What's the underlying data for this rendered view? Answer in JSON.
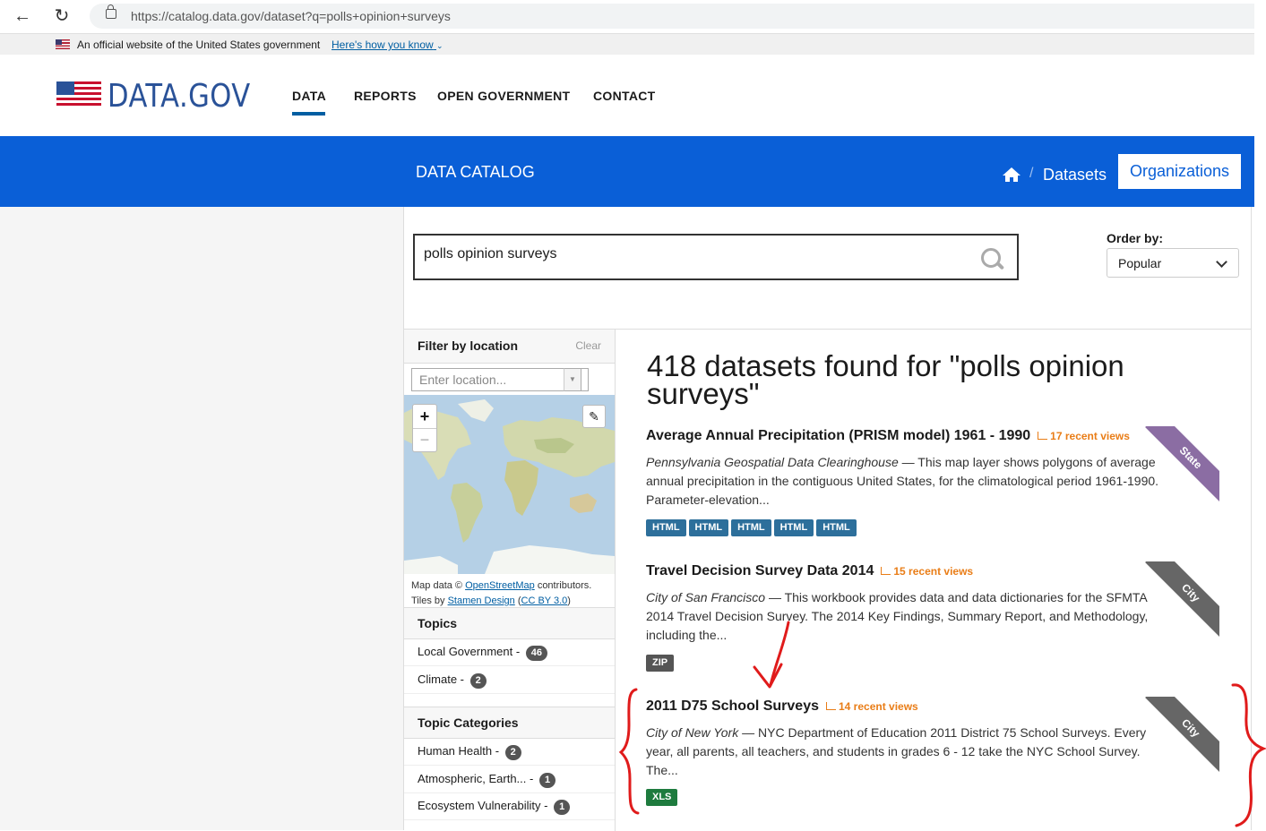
{
  "browser": {
    "url": "https://catalog.data.gov/dataset?q=polls+opinion+surveys"
  },
  "gov_banner": {
    "text": "An official website of the United States government",
    "link": "Here's how you know"
  },
  "header": {
    "logo": "DATA.GOV",
    "nav": [
      "DATA",
      "REPORTS",
      "OPEN GOVERNMENT",
      "CONTACT"
    ]
  },
  "band": {
    "title": "DATA CATALOG",
    "crumb": "Datasets",
    "org_button": "Organizations"
  },
  "search": {
    "query": "polls opinion surveys",
    "order_label": "Order by:",
    "order_value": "Popular"
  },
  "sidebar": {
    "filter_title": "Filter by location",
    "filter_clear": "Clear",
    "location_placeholder": "Enter location...",
    "map_credit_1": "Map data ©",
    "map_credit_osm": "OpenStreetMap",
    "map_credit_2": "contributors.",
    "map_credit_3": "Tiles by",
    "map_credit_stamen": "Stamen Design",
    "map_credit_cc": "CC BY 3.0",
    "topics_title": "Topics",
    "topics": [
      {
        "label": "Local Government -",
        "count": "46"
      },
      {
        "label": "Climate -",
        "count": "2"
      }
    ],
    "categories_title": "Topic Categories",
    "categories": [
      {
        "label": "Human Health -",
        "count": "2"
      },
      {
        "label": "Atmospheric, Earth... -",
        "count": "1"
      },
      {
        "label": "Ecosystem Vulnerability -",
        "count": "1"
      }
    ]
  },
  "results": {
    "heading": "418 datasets found for \"polls opinion surveys\"",
    "items": [
      {
        "title": "Average Annual Precipitation (PRISM model) 1961 - 1990",
        "views": "17 recent views",
        "source": "Pennsylvania Geospatial Data Clearinghouse",
        "desc": " — This map layer shows polygons of average annual precipitation in the contiguous United States, for the climatological period 1961-1990. Parameter-elevation...",
        "tags": [
          "HTML",
          "HTML",
          "HTML",
          "HTML",
          "HTML"
        ],
        "ribbon": "State"
      },
      {
        "title": "Travel Decision Survey Data 2014",
        "views": "15 recent views",
        "source": "City of San Francisco",
        "desc": " — This workbook provides data and data dictionaries for the SFMTA 2014 Travel Decision Survey. The 2014 Key Findings, Summary Report, and Methodology, including the...",
        "tags": [
          "ZIP"
        ],
        "ribbon": "City"
      },
      {
        "title": "2011 D75 School Surveys",
        "views": "14 recent views",
        "source": "City of New York",
        "desc": " — NYC Department of Education 2011 District 75 School Surveys. Every year, all parents, all teachers, and students in grades 6 - 12 take the NYC School Survey. The...",
        "tags": [
          "XLS"
        ],
        "ribbon": "City"
      }
    ]
  },
  "colors": {
    "brand_blue": "#0a5fd7",
    "html_tag": "#2d6f9b",
    "zip_tag": "#555555",
    "xls_tag": "#1e7b3e",
    "state_ribbon": "#8b6da3",
    "city_ribbon": "#666666",
    "views_orange": "#e97d17",
    "annotation_red": "#e01b1b"
  }
}
